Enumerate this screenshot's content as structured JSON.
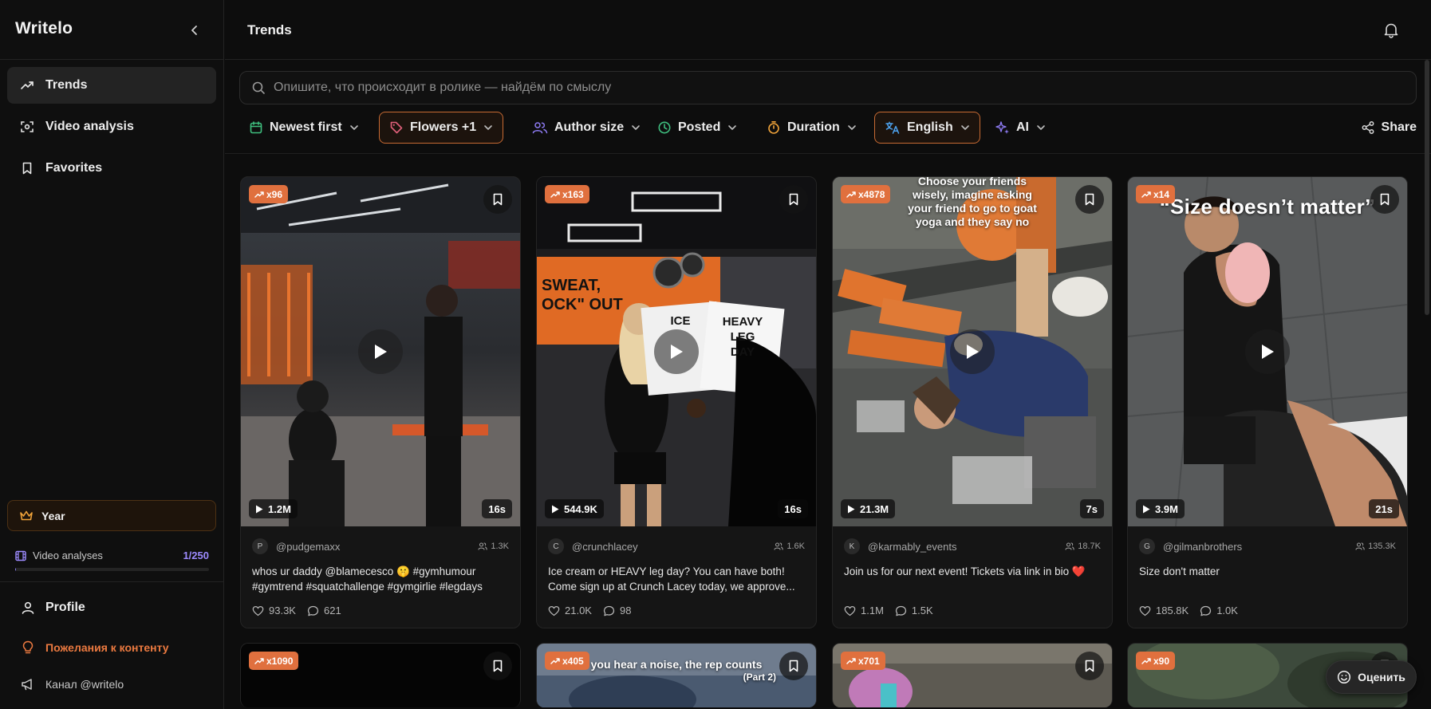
{
  "app": {
    "brand": "Writelo",
    "page_title": "Trends"
  },
  "sidebar": {
    "nav": [
      {
        "label": "Trends",
        "icon": "trending-up-icon",
        "active": true
      },
      {
        "label": "Video analysis",
        "icon": "scan-icon",
        "active": false
      },
      {
        "label": "Favorites",
        "icon": "bookmark-icon",
        "active": false
      }
    ],
    "plan": {
      "label": "Year",
      "icon": "crown-icon"
    },
    "usage": {
      "label": "Video analyses",
      "count": "1/250",
      "used": 1,
      "limit": 250
    },
    "profile": "Profile",
    "feedback": "Пожелания к контенту",
    "channel": "Канал @writelo"
  },
  "search": {
    "placeholder": "Опишите, что происходит в ролике — найдём по смыслу",
    "value": ""
  },
  "filters": [
    {
      "label": "Newest first",
      "icon": "calendar-icon",
      "icon_color": "#3fbf7f",
      "highlight": false
    },
    {
      "label": "Flowers +1",
      "icon": "tag-icon",
      "icon_color": "#e0607a",
      "highlight": true
    },
    {
      "label": "Author size",
      "icon": "users-icon",
      "icon_color": "#8f7cf6",
      "highlight": false
    },
    {
      "label": "Posted",
      "icon": "clock-icon",
      "icon_color": "#3fbf7f",
      "highlight": false
    },
    {
      "label": "Duration",
      "icon": "timer-icon",
      "icon_color": "#f0a33a",
      "highlight": false
    },
    {
      "label": "English",
      "icon": "translate-icon",
      "icon_color": "#4da3f0",
      "highlight": true
    },
    {
      "label": "AI",
      "icon": "sparkles-icon",
      "icon_color": "#8f7cf6",
      "highlight": false
    }
  ],
  "share_label": "Share",
  "rate_label": "Оценить",
  "videos": [
    {
      "trend": "x96",
      "views": "1.2M",
      "duration": "16s",
      "avatar": "P",
      "author": "@pudgemaxx",
      "followers": "1.3K",
      "caption": "whos ur daddy @blamecesco 🤫 #gymhumour #gymtrend #squatchallenge #gymgirlie #legdays",
      "likes": "93.3K",
      "comments": "621"
    },
    {
      "trend": "x163",
      "views": "544.9K",
      "duration": "16s",
      "avatar": "C",
      "author": "@crunchlacey",
      "followers": "1.6K",
      "caption": "Ice cream or HEAVY leg day? You can have both! Come sign up at Crunch Lacey today, we approve...",
      "likes": "21.0K",
      "comments": "98",
      "overlay": [
        "SWEAT,",
        "OCK\" OUT",
        "ICE",
        "HEAVY",
        "LEG",
        "DAY"
      ]
    },
    {
      "trend": "x4878",
      "views": "21.3M",
      "duration": "7s",
      "avatar": "K",
      "author": "@karmably_events",
      "followers": "18.7K",
      "caption": "Join us for our next event! Tickets via link in bio ❤️",
      "likes": "1.1M",
      "comments": "1.5K",
      "overlay": [
        "Choose your friends",
        "wisely, imagine asking",
        "your friend to go to goat",
        "yoga and they say no"
      ]
    },
    {
      "trend": "x14",
      "views": "3.9M",
      "duration": "21s",
      "avatar": "G",
      "author": "@gilmanbrothers",
      "followers": "135.3K",
      "caption": "Size don't matter",
      "likes": "185.8K",
      "comments": "1.0K",
      "overlay": [
        "“Size doesn’t matter”"
      ]
    }
  ],
  "videos_row2": [
    {
      "trend": "x1090"
    },
    {
      "trend": "x405",
      "overlay": [
        "you hear a noise, the rep counts",
        "(Part 2)"
      ]
    },
    {
      "trend": "x701"
    },
    {
      "trend": "x90"
    }
  ],
  "colors": {
    "accent": "#e0703e",
    "usage": "#8a7cf0",
    "feedback": "#ec7a40"
  }
}
